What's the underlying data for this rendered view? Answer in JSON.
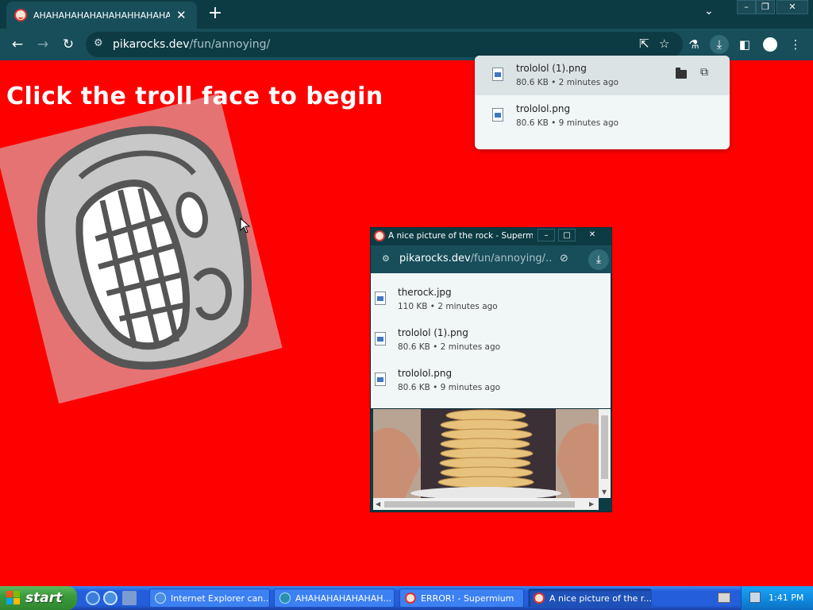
{
  "browser": {
    "tab_title": "AHAHAHAHAHAHAHAHHAHAHAHAHAHAHAHA",
    "address_host": "pikarocks.dev",
    "address_path": "/fun/annoying/"
  },
  "page": {
    "headline": "Click the troll face to begin"
  },
  "downloads": [
    {
      "name": "trololol (1).png",
      "meta": "80.6 KB • 2 minutes ago"
    },
    {
      "name": "trololol.png",
      "meta": "80.6 KB • 9 minutes ago"
    }
  ],
  "popup": {
    "title": "A nice picture of the rock - Supermium",
    "address_host": "pikarocks.dev",
    "address_path": "/fun/annoying/...",
    "downloads": [
      {
        "name": "therock.jpg",
        "meta": "110 KB • 2 minutes ago"
      },
      {
        "name": "trololol (1).png",
        "meta": "80.6 KB • 2 minutes ago"
      },
      {
        "name": "trololol.png",
        "meta": "80.6 KB • 9 minutes ago"
      }
    ]
  },
  "taskbar": {
    "start_label": "start",
    "tasks": [
      {
        "label": "Internet Explorer can..."
      },
      {
        "label": "AHAHAHAHAHAHAH..."
      },
      {
        "label": "ERROR! - Supermium"
      },
      {
        "label": "A nice picture of the r..."
      }
    ],
    "clock": "1:41 PM"
  },
  "icons": {
    "back": "arrow-left-icon",
    "forward": "arrow-right-icon",
    "reload": "reload-icon",
    "download": "download-icon",
    "star": "star-icon"
  },
  "colors": {
    "page_background": "#ff0000",
    "browser_frame": "#0d3b44",
    "browser_toolbar": "#174e5a"
  }
}
